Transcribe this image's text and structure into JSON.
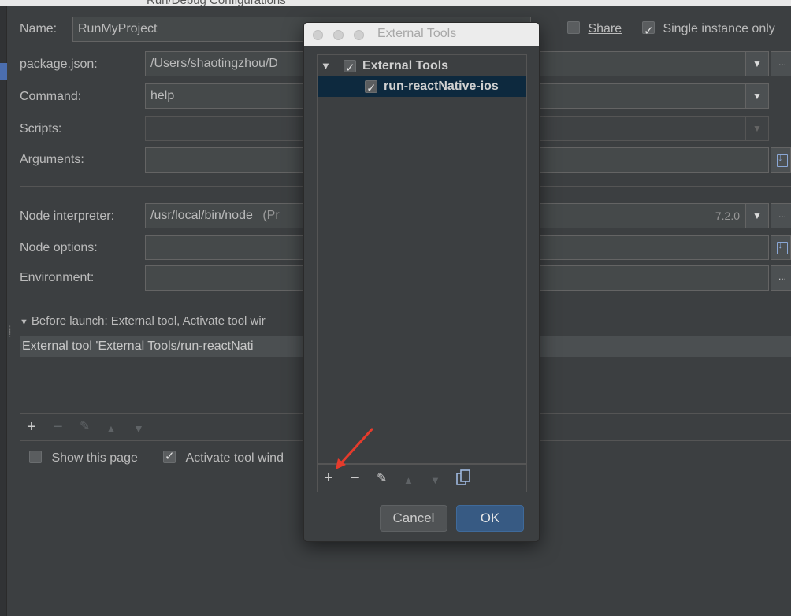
{
  "window": {
    "title_fragment": "Run/Debug Configurations"
  },
  "top": {
    "name_label": "Name:",
    "name_value": "RunMyProject",
    "share_label": "Share",
    "share_checked": false,
    "single_instance_label": "Single instance only",
    "single_instance_checked": true
  },
  "form": {
    "package_json_label": "package.json:",
    "package_json_value": "/Users/shaotingzhou/D",
    "command_label": "Command:",
    "command_value": "help",
    "scripts_label": "Scripts:",
    "arguments_label": "Arguments:",
    "node_interpreter_label": "Node interpreter:",
    "node_interpreter_value": "/usr/local/bin/node",
    "node_interpreter_hint": "(Pr",
    "node_version": "7.2.0",
    "node_options_label": "Node options:",
    "environment_label": "Environment:",
    "ellipsis": "..."
  },
  "before_launch": {
    "header": "Before launch: External tool, Activate tool wir",
    "item": "External tool 'External Tools/run-reactNati"
  },
  "bottom": {
    "show_page_label": "Show this page",
    "show_page_checked": false,
    "activate_tool_label": "Activate tool wind",
    "activate_tool_checked": true
  },
  "dialog": {
    "title": "External Tools",
    "tree": {
      "group": {
        "label": "External Tools",
        "checked": true
      },
      "items": [
        {
          "label": "run-reactNative-ios",
          "checked": true,
          "selected": true
        }
      ]
    },
    "cancel_label": "Cancel",
    "ok_label": "OK"
  },
  "colors": {
    "background": "#3c3f41",
    "selection": "#0d293e",
    "ok_button": "#375a83",
    "annotation_arrow": "#e53b2c"
  }
}
